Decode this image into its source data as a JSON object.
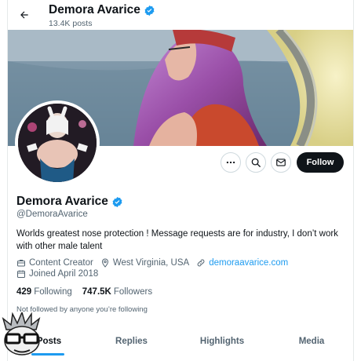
{
  "header": {
    "name": "Demora Avarice",
    "posts_count": "13.4K posts"
  },
  "profile": {
    "name": "Demora Avarice",
    "handle": "@DemoraAvarice",
    "bio": "Worlds greatest nose protection ! Message requests are for industry, I don’t work with other male talent",
    "category": "Content Creator",
    "location": "West Virginia, USA",
    "website": "demoraavarice.com",
    "joined": "Joined April 2018",
    "following_count": "429",
    "following_label": "Following",
    "followers_count": "747.5K",
    "followers_label": "Followers",
    "not_followed_text": "Not followed by anyone you’re following",
    "verified": true
  },
  "actions": {
    "follow_label": "Follow"
  },
  "tabs": [
    {
      "label": "Posts",
      "active": true
    },
    {
      "label": "Replies",
      "active": false
    },
    {
      "label": "Highlights",
      "active": false
    },
    {
      "label": "Media",
      "active": false
    }
  ],
  "icons": {
    "back": "arrow-left-icon",
    "verified": "verified-badge-icon",
    "more": "more-icon",
    "search": "search-icon",
    "message": "message-icon",
    "category": "briefcase-icon",
    "location": "location-pin-icon",
    "website": "link-icon",
    "joined": "calendar-icon"
  },
  "colors": {
    "accent": "#1d9bf0",
    "text_primary": "#0f1419",
    "text_secondary": "#536471",
    "follow_button_bg": "#0f1419"
  }
}
